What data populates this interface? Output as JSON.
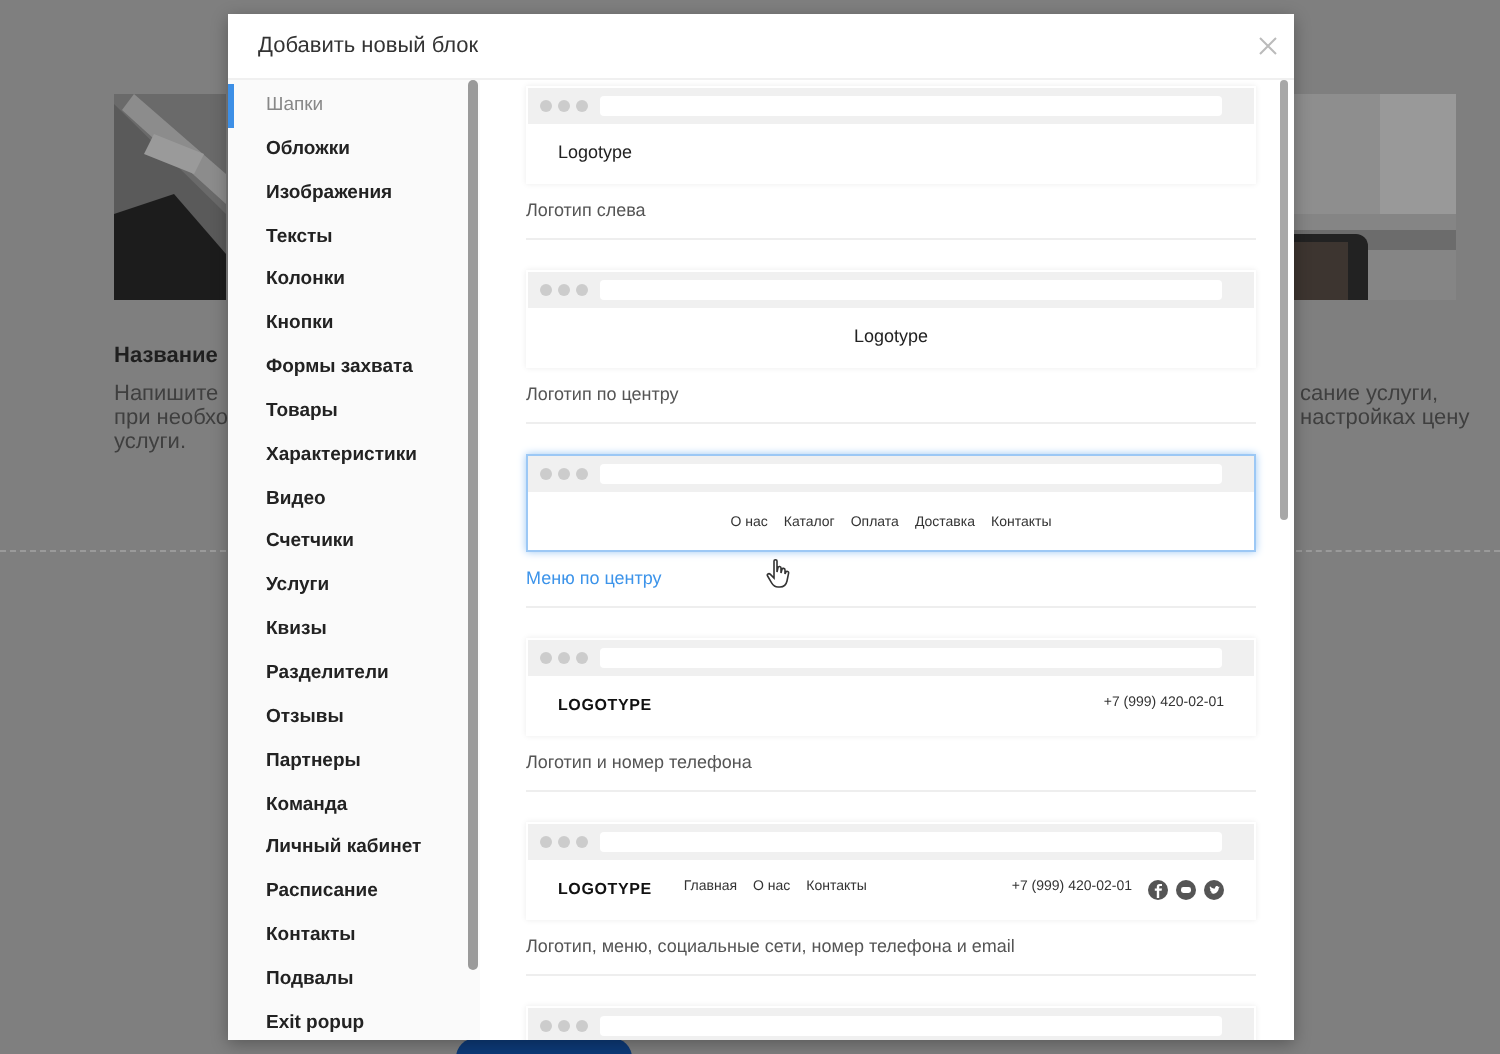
{
  "background": {
    "pictures": [
      {
        "kind": "picture"
      },
      {
        "kind": "picture"
      }
    ],
    "card_title": "Название",
    "desc_left": [
      "Напишите",
      "при необхо",
      "услуги."
    ],
    "desc_right": [
      "сание услуги,",
      "настройках цену"
    ]
  },
  "modal": {
    "title": "Добавить новый блок"
  },
  "sidebar": {
    "items": [
      {
        "label": "Шапки",
        "selected": true
      },
      {
        "label": "Обложки",
        "selected": false
      },
      {
        "label": "Изображения",
        "selected": false
      },
      {
        "label": "Тексты",
        "selected": false
      },
      {
        "label": "Колонки",
        "selected": false
      },
      {
        "label": "Кнопки",
        "selected": false
      },
      {
        "label": "Формы захвата",
        "selected": false
      },
      {
        "label": "Товары",
        "selected": false
      },
      {
        "label": "Характеристики",
        "selected": false
      },
      {
        "label": "Видео",
        "selected": false
      },
      {
        "label": "Счетчики",
        "selected": false
      },
      {
        "label": "Услуги",
        "selected": false
      },
      {
        "label": "Квизы",
        "selected": false
      },
      {
        "label": "Разделители",
        "selected": false
      },
      {
        "label": "Отзывы",
        "selected": false
      },
      {
        "label": "Партнеры",
        "selected": false
      },
      {
        "label": "Команда",
        "selected": false
      },
      {
        "label": "Личный кабинет",
        "selected": false
      },
      {
        "label": "Расписание",
        "selected": false
      },
      {
        "label": "Контакты",
        "selected": false
      },
      {
        "label": "Подвалы",
        "selected": false
      },
      {
        "label": "Exit popup",
        "selected": false
      }
    ]
  },
  "blocks": [
    {
      "kind": "logo-left",
      "logo": "Logotype",
      "caption": "Логотип слева",
      "selected": false
    },
    {
      "kind": "logo-center",
      "logo": "Logotype",
      "caption": "Логотип по центру",
      "selected": false
    },
    {
      "kind": "menu-center",
      "menu": [
        "О нас",
        "Каталог",
        "Оплата",
        "Доставка",
        "Контакты"
      ],
      "caption": "Меню по центру",
      "selected": true
    },
    {
      "kind": "logo-phone",
      "logo": "LOGOTYPE",
      "phone": "+7 (999) 420-02-01",
      "caption": "Логотип и номер телефона",
      "selected": false
    },
    {
      "kind": "full",
      "logo": "LOGOTYPE",
      "menu": [
        "Главная",
        "О нас",
        "Контакты"
      ],
      "phone": "+7 (999) 420-02-01",
      "caption": "Логотип, меню, социальные сети, номер телефона и email",
      "selected": false
    },
    {
      "kind": "bar-only",
      "selected": false
    }
  ]
}
